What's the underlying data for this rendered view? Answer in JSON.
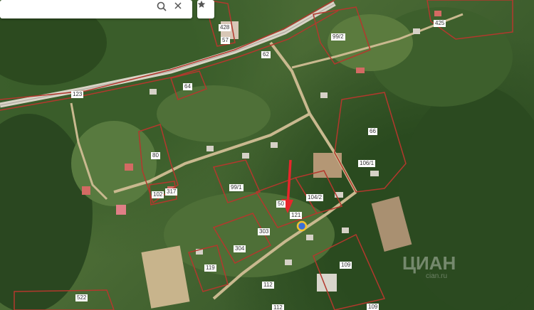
{
  "search": {
    "value": "",
    "placeholder": ""
  },
  "icons": {
    "search": "search-icon",
    "close": "close-icon",
    "favorite": "star-icon",
    "location": "location-pin-icon",
    "arrow": "red-arrow-icon"
  },
  "colors": {
    "boundary": "#b3382d",
    "road": "#c9b98f",
    "highway": "#d9d4c6",
    "label_bg": "#ffffff",
    "arrow": "#e8262b",
    "pin": "#3a6fd8",
    "pin_ring": "#f2c230"
  },
  "plots": [
    {
      "id": "p428",
      "label": "428"
    },
    {
      "id": "p57",
      "label": "57"
    },
    {
      "id": "p99_2",
      "label": "99/2"
    },
    {
      "id": "p425",
      "label": "425"
    },
    {
      "id": "p123",
      "label": "123"
    },
    {
      "id": "p64",
      "label": "64"
    },
    {
      "id": "p66",
      "label": "66"
    },
    {
      "id": "p80",
      "label": "80"
    },
    {
      "id": "p106_1",
      "label": "106/1"
    },
    {
      "id": "p102",
      "label": "102"
    },
    {
      "id": "p317",
      "label": "317"
    },
    {
      "id": "p99_1",
      "label": "99/1"
    },
    {
      "id": "p104_2",
      "label": "104/2"
    },
    {
      "id": "p121",
      "label": "121"
    },
    {
      "id": "p303",
      "label": "303"
    },
    {
      "id": "p304",
      "label": "304"
    },
    {
      "id": "p119",
      "label": "119"
    },
    {
      "id": "p112",
      "label": "112"
    },
    {
      "id": "p109a",
      "label": "109"
    },
    {
      "id": "p109b",
      "label": "109"
    },
    {
      "id": "p522",
      "label": "522"
    },
    {
      "id": "p62",
      "label": "62"
    },
    {
      "id": "p50",
      "label": "50"
    },
    {
      "id": "p112b",
      "label": "112"
    }
  ],
  "watermark": {
    "text": "ЦИАН",
    "sub": "cian.ru"
  }
}
